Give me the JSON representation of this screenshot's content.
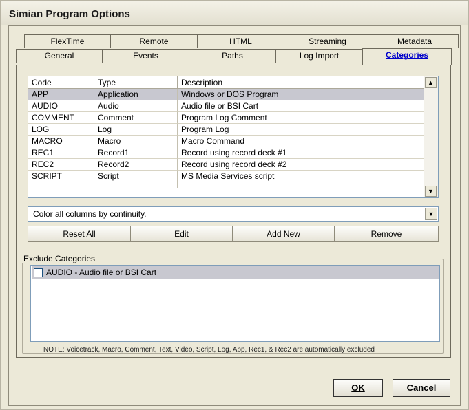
{
  "window": {
    "title": "Simian Program Options"
  },
  "tabs": {
    "back_row": [
      "FlexTime",
      "Remote",
      "HTML",
      "Streaming",
      "Metadata"
    ],
    "front_row": [
      "General",
      "Events",
      "Paths",
      "Log Import",
      "Categories"
    ],
    "active": "Categories"
  },
  "categories_table": {
    "columns": [
      "Code",
      "Type",
      "Description"
    ],
    "rows": [
      [
        "APP",
        "Application",
        "Windows or DOS Program"
      ],
      [
        "AUDIO",
        "Audio",
        "Audio file or BSI Cart"
      ],
      [
        "COMMENT",
        "Comment",
        "Program Log Comment"
      ],
      [
        "LOG",
        "Log",
        "Program Log"
      ],
      [
        "MACRO",
        "Macro",
        "Macro Command"
      ],
      [
        "REC1",
        "Record1",
        "Record using record deck #1"
      ],
      [
        "REC2",
        "Record2",
        "Record using record deck #2"
      ],
      [
        "SCRIPT",
        "Script",
        "MS Media Services script"
      ]
    ],
    "selected_row": 0
  },
  "color_mode": {
    "value": "Color all columns by continuity."
  },
  "actions": {
    "reset_all": "Reset All",
    "edit": "Edit",
    "add_new": "Add New",
    "remove": "Remove"
  },
  "exclude": {
    "legend": "Exclude Categories",
    "items": [
      {
        "label": "AUDIO  -  Audio file or BSI Cart",
        "checked": false
      }
    ],
    "note": "NOTE: Voicetrack, Macro, Comment, Text, Video, Script, Log, App, Rec1, & Rec2 are automatically excluded"
  },
  "dialog": {
    "ok": "OK",
    "cancel": "Cancel"
  },
  "icons": {
    "scroll_up": "up-arrow-icon",
    "scroll_down": "down-arrow-icon",
    "dropdown": "chevron-down-icon"
  }
}
